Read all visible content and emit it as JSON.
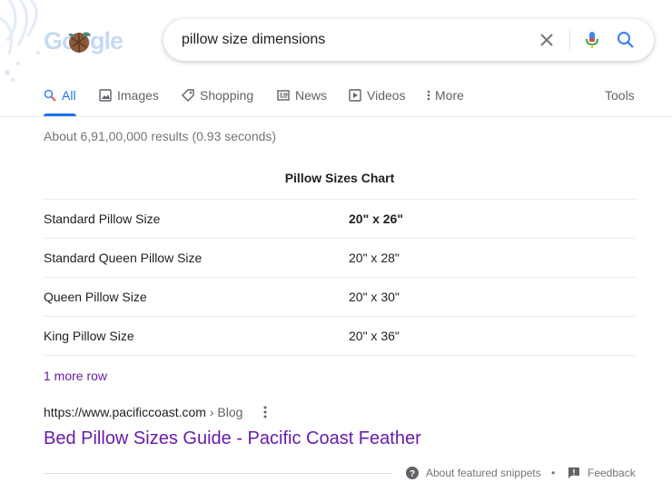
{
  "logo": {
    "text": "Google"
  },
  "search": {
    "query": "pillow size dimensions"
  },
  "tabs": [
    {
      "label": "All",
      "icon": "search-icon"
    },
    {
      "label": "Images",
      "icon": "image-icon"
    },
    {
      "label": "Shopping",
      "icon": "tag-icon"
    },
    {
      "label": "News",
      "icon": "news-icon"
    },
    {
      "label": "Videos",
      "icon": "play-icon"
    },
    {
      "label": "More",
      "icon": "kebab-icon"
    }
  ],
  "tools_label": "Tools",
  "stats": "About 6,91,00,000 results (0.93 seconds)",
  "snippet": {
    "title": "Pillow Sizes Chart",
    "rows": [
      {
        "name": "Standard Pillow Size",
        "size": "20\" x 26\""
      },
      {
        "name": "Standard Queen Pillow Size",
        "size": "20\" x 28\""
      },
      {
        "name": "Queen Pillow Size",
        "size": "20\" x 30\""
      },
      {
        "name": "King Pillow Size",
        "size": "20\" x 36\""
      }
    ],
    "more_rows": "1 more row"
  },
  "result": {
    "url": "https://www.pacificcoast.com",
    "breadcrumb": " › Blog",
    "title": "Bed Pillow Sizes Guide - Pacific Coast Feather"
  },
  "footer": {
    "about": "About featured snippets",
    "separator": "•",
    "feedback": "Feedback"
  },
  "colors": {
    "accent": "#1a73e8",
    "visited_link": "#681da8",
    "muted": "#70757a"
  }
}
